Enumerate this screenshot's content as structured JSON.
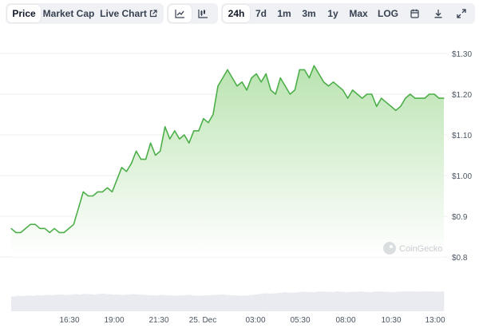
{
  "toolbar": {
    "tabs": [
      {
        "label": "Price",
        "active": true
      },
      {
        "label": "Market Cap",
        "active": false
      },
      {
        "label": "Live Chart",
        "active": false,
        "icon": "external-link-icon"
      }
    ],
    "chart_types": [
      {
        "icon": "line-chart-icon",
        "active": true
      },
      {
        "icon": "candlestick-chart-icon",
        "active": false
      }
    ],
    "ranges": [
      {
        "label": "24h",
        "active": true
      },
      {
        "label": "7d",
        "active": false
      },
      {
        "label": "1m",
        "active": false
      },
      {
        "label": "3m",
        "active": false
      },
      {
        "label": "1y",
        "active": false
      },
      {
        "label": "Max",
        "active": false
      },
      {
        "label": "LOG",
        "active": false
      }
    ],
    "actions": [
      {
        "icon": "calendar-icon"
      },
      {
        "icon": "download-icon"
      },
      {
        "icon": "expand-icon"
      }
    ]
  },
  "watermark": "CoinGecko",
  "chart_data": {
    "type": "area",
    "title": "",
    "xlabel": "",
    "ylabel": "",
    "x_ticks": [
      "16:30",
      "19:00",
      "21:30",
      "25. Dec",
      "03:00",
      "05:30",
      "08:00",
      "10:30",
      "13:00"
    ],
    "y_ticks": [
      "$0.8",
      "$0.9",
      "$1.00",
      "$1.10",
      "$1.20",
      "$1.30"
    ],
    "ylim": [
      0.8,
      1.3
    ],
    "y_axis_side": "right",
    "grid": true,
    "colors": {
      "line": "#4daf4a",
      "fill_top": "#b9e3b0",
      "fill_bottom": "#ffffff",
      "volume": "#e9ebf0"
    },
    "series": [
      {
        "values": [
          0.87,
          0.86,
          0.86,
          0.87,
          0.88,
          0.88,
          0.87,
          0.87,
          0.86,
          0.87,
          0.86,
          0.86,
          0.87,
          0.88,
          0.92,
          0.96,
          0.95,
          0.95,
          0.96,
          0.96,
          0.97,
          0.96,
          0.99,
          1.02,
          1.01,
          1.03,
          1.06,
          1.04,
          1.04,
          1.08,
          1.05,
          1.06,
          1.12,
          1.09,
          1.11,
          1.09,
          1.1,
          1.08,
          1.11,
          1.11,
          1.14,
          1.13,
          1.15,
          1.22,
          1.24,
          1.26,
          1.24,
          1.22,
          1.23,
          1.21,
          1.24,
          1.25,
          1.23,
          1.25,
          1.21,
          1.2,
          1.24,
          1.22,
          1.2,
          1.21,
          1.26,
          1.26,
          1.24,
          1.27,
          1.25,
          1.23,
          1.22,
          1.23,
          1.22,
          1.21,
          1.19,
          1.21,
          1.2,
          1.19,
          1.2,
          1.2,
          1.17,
          1.19,
          1.18,
          1.17,
          1.16,
          1.17,
          1.19,
          1.2,
          1.19,
          1.19,
          1.19,
          1.2,
          1.2,
          1.19,
          1.19
        ]
      }
    ],
    "volume": [
      0.55,
      0.57,
      0.56,
      0.58,
      0.57,
      0.59,
      0.58,
      0.6,
      0.59,
      0.61,
      0.62,
      0.6,
      0.61,
      0.63,
      0.62,
      0.64,
      0.63,
      0.62,
      0.64,
      0.65,
      0.63,
      0.62,
      0.61,
      0.6,
      0.62,
      0.63,
      0.62,
      0.61,
      0.6,
      0.59,
      0.58,
      0.6,
      0.59,
      0.58,
      0.57,
      0.58,
      0.59,
      0.6,
      0.58,
      0.57,
      0.58,
      0.59,
      0.6,
      0.61,
      0.62,
      0.6,
      0.59,
      0.58,
      0.57,
      0.58,
      0.6,
      0.62,
      0.64,
      0.66,
      0.65,
      0.66,
      0.68,
      0.7,
      0.69,
      0.68,
      0.7,
      0.72,
      0.71,
      0.7,
      0.72,
      0.73,
      0.72,
      0.71,
      0.73,
      0.72,
      0.7,
      0.71,
      0.72,
      0.73,
      0.71,
      0.7,
      0.72,
      0.73,
      0.72,
      0.71,
      0.7,
      0.72,
      0.73,
      0.74,
      0.73,
      0.72,
      0.73,
      0.74,
      0.73,
      0.72,
      0.73
    ]
  }
}
